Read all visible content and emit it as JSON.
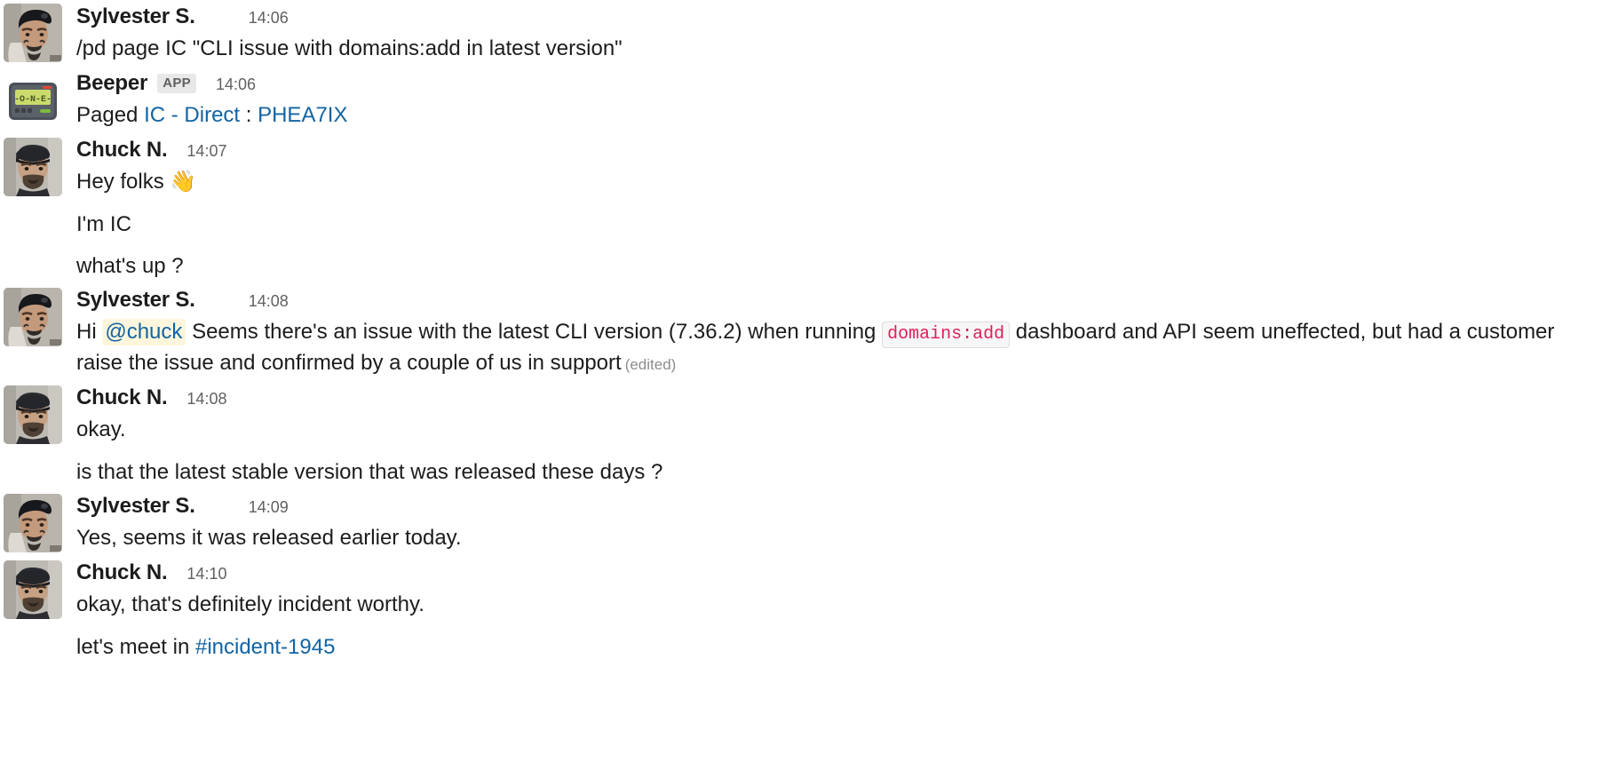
{
  "app": "slack-conversation",
  "colors": {
    "link": "#1264a3",
    "mention_bg": "#fdf6dc",
    "code_text": "#e01e5a",
    "code_bg": "#f6f6f6",
    "text": "#1d1c1d",
    "meta_text": "#616061",
    "background": "#ffffff"
  },
  "messages": [
    {
      "id": "m1",
      "author": "Sylvester S.",
      "avatar": "sylvester-avatar",
      "time": "14:06",
      "is_app": false,
      "badge": null,
      "body": "/pd page IC \"CLI issue with domains:add in latest version\""
    },
    {
      "id": "m2",
      "author": "Beeper",
      "avatar": "beeper-pager-avatar",
      "time": "14:06",
      "is_app": true,
      "badge": "APP",
      "body_prefix": "Paged ",
      "link_1": "IC - Direct",
      "separator": " : ",
      "link_2": "PHEA7IX"
    },
    {
      "id": "m3",
      "author": "Chuck N.",
      "avatar": "chuck-avatar",
      "time": "14:07",
      "is_app": false,
      "badge": null,
      "body": "Hey folks ",
      "emoji": "👋",
      "followups": [
        "I'm IC",
        "what's up ?"
      ]
    },
    {
      "id": "m4",
      "author": "Sylvester S.",
      "avatar": "sylvester-avatar",
      "time": "14:08",
      "is_app": false,
      "badge": null,
      "seg_1": "Hi ",
      "mention": "@chuck",
      "seg_2": " Seems there's an issue with the latest CLI version (7.36.2) when running ",
      "code": "domains:add",
      "seg_3": " dashboard and API seem uneffected, but had a customer raise the issue and confirmed by a couple of us in support",
      "edited": "(edited)"
    },
    {
      "id": "m5",
      "author": "Chuck N.",
      "avatar": "chuck-avatar",
      "time": "14:08",
      "is_app": false,
      "badge": null,
      "body": "okay.",
      "followups": [
        "is that the latest stable version that was released these days ?"
      ]
    },
    {
      "id": "m6",
      "author": "Sylvester S.",
      "avatar": "sylvester-avatar",
      "time": "14:09",
      "is_app": false,
      "badge": null,
      "body": "Yes, seems it was released earlier today."
    },
    {
      "id": "m7",
      "author": "Chuck N.",
      "avatar": "chuck-avatar",
      "time": "14:10",
      "is_app": false,
      "badge": null,
      "body": "okay, that's definitely incident worthy.",
      "followup_prefix": "let's meet in ",
      "followup_link": "#incident-1945"
    }
  ]
}
